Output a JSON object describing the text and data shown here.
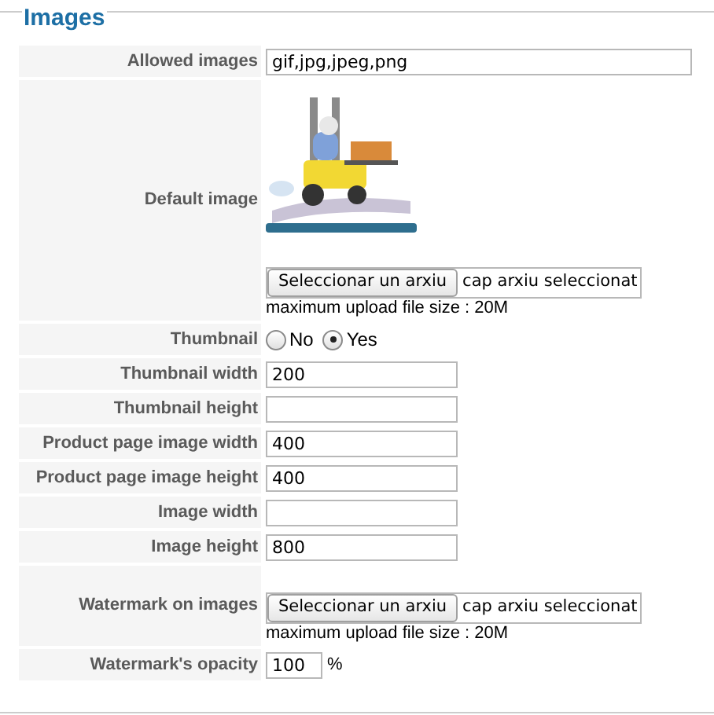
{
  "legend": "Images",
  "rows": [
    {
      "label": "Allowed images",
      "kind": "wide_text",
      "value": "gif,jpg,jpeg,png"
    },
    {
      "label": "Default image",
      "file": {
        "button": "Seleccionar un arxiu",
        "status": "cap arxiu seleccionat"
      },
      "note": "maximum upload file size : 20M"
    },
    {
      "label": "Thumbnail",
      "kind": "radio",
      "options": [
        {
          "label": "No",
          "selected": false
        },
        {
          "label": "Yes",
          "selected": true
        }
      ]
    },
    {
      "label": "Thumbnail width",
      "kind": "text",
      "value": "200"
    },
    {
      "label": "Thumbnail height",
      "kind": "text"
    },
    {
      "label": "Product page image width",
      "kind": "text",
      "value": "400"
    },
    {
      "label": "Product page image height",
      "kind": "text",
      "value": "400"
    },
    {
      "label": "Image width",
      "kind": "text"
    },
    {
      "label": "Image height",
      "kind": "text",
      "value": "800"
    },
    {
      "label": "Watermark on images",
      "kind": "file",
      "file": {
        "button": "Seleccionar un arxiu",
        "status": "cap arxiu seleccionat"
      },
      "note": "maximum upload file size : 20M"
    },
    {
      "label": "Watermark's opacity",
      "kind": "percent",
      "value": "100",
      "suffix": "%"
    }
  ]
}
